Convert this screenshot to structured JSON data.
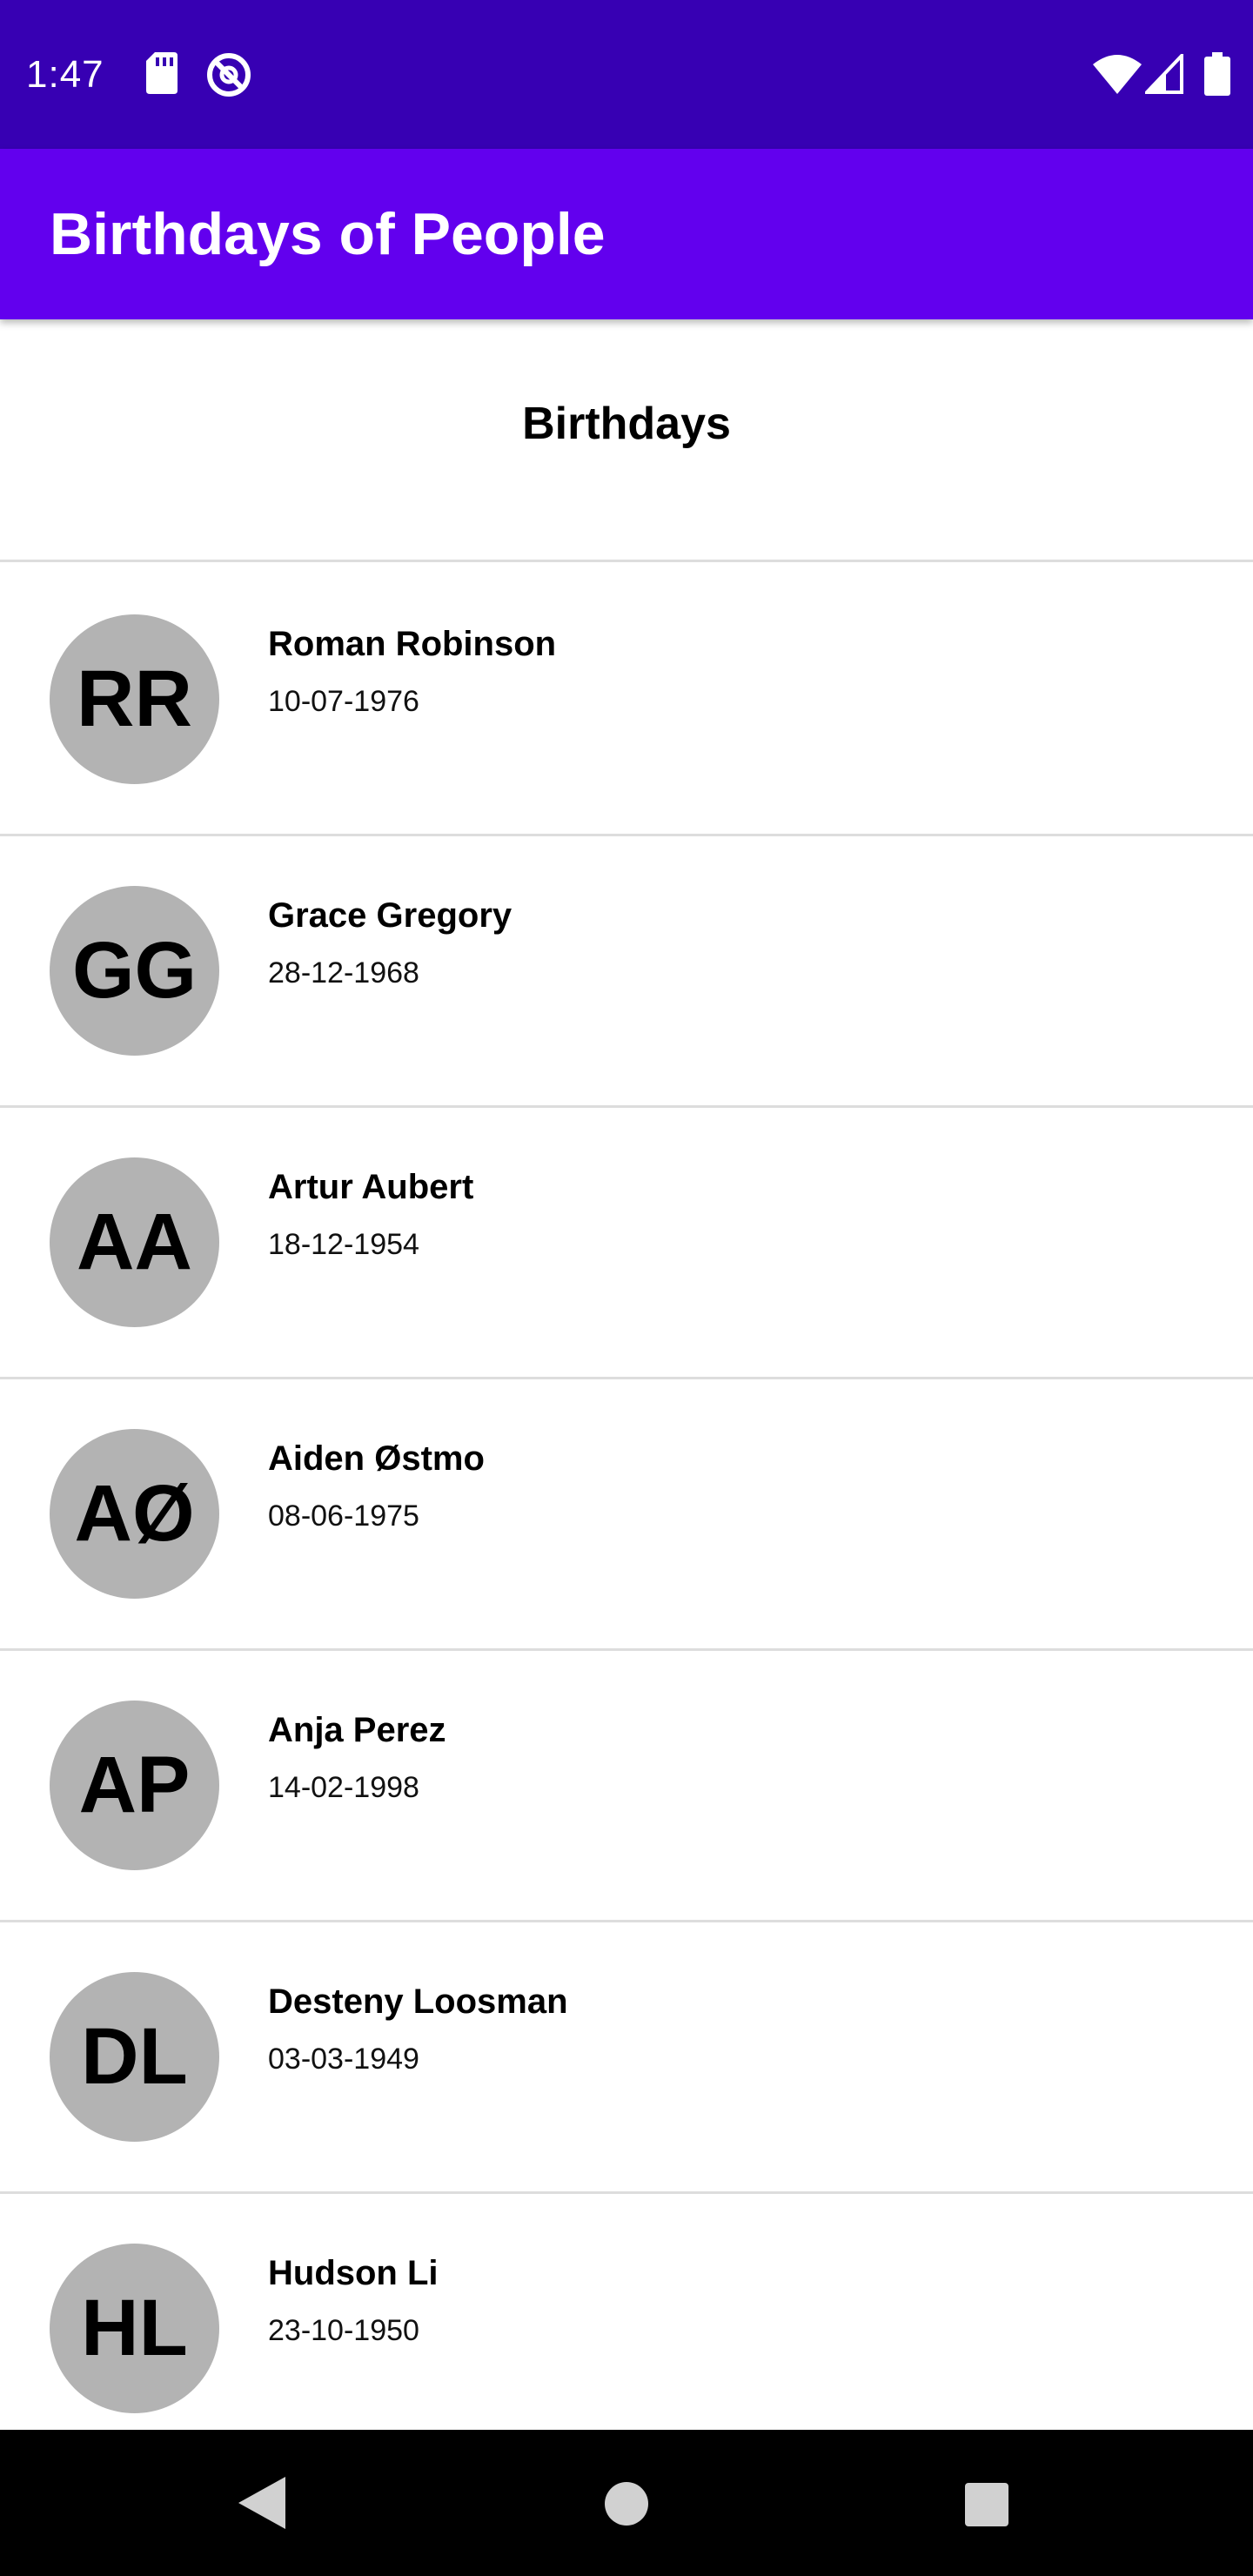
{
  "status_bar": {
    "time": "1:47",
    "left_icons": [
      "sd-card-icon",
      "do-not-disturb-icon"
    ],
    "right_icons": [
      "wifi-icon",
      "signal-icon",
      "battery-icon"
    ]
  },
  "app_bar": {
    "title": "Birthdays of People",
    "color": "#6200ee",
    "status_color": "#3700b3"
  },
  "list": {
    "header": "Birthdays",
    "avatar_color": "#b3b3b3",
    "items": [
      {
        "initials": "RR",
        "name": "Roman Robinson",
        "date": "10-07-1976"
      },
      {
        "initials": "GG",
        "name": "Grace Gregory",
        "date": "28-12-1968"
      },
      {
        "initials": "AA",
        "name": "Artur Aubert",
        "date": "18-12-1954"
      },
      {
        "initials": "AØ",
        "name": "Aiden Østmo",
        "date": "08-06-1975"
      },
      {
        "initials": "AP",
        "name": "Anja Perez",
        "date": "14-02-1998"
      },
      {
        "initials": "DL",
        "name": "Desteny Loosman",
        "date": "03-03-1949"
      },
      {
        "initials": "HL",
        "name": "Hudson Li",
        "date": "23-10-1950"
      }
    ]
  },
  "nav_bar": {
    "buttons": [
      "back-icon",
      "home-icon",
      "recents-icon"
    ]
  }
}
